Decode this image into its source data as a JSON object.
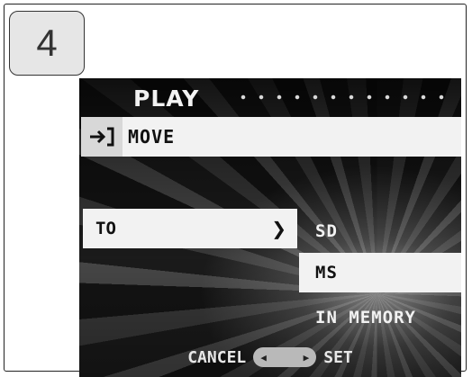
{
  "step": {
    "number": "4"
  },
  "screen": {
    "title": "PLAY",
    "menu": {
      "item_label": "MOVE",
      "icon": "move-icon"
    },
    "target": {
      "label": "TO",
      "arrow": "❯"
    },
    "options": [
      {
        "label": "SD",
        "selected": false
      },
      {
        "label": "MS",
        "selected": true
      },
      {
        "label": "IN MEMORY",
        "selected": false
      }
    ],
    "footer": {
      "cancel_label": "CANCEL",
      "set_label": "SET"
    }
  }
}
